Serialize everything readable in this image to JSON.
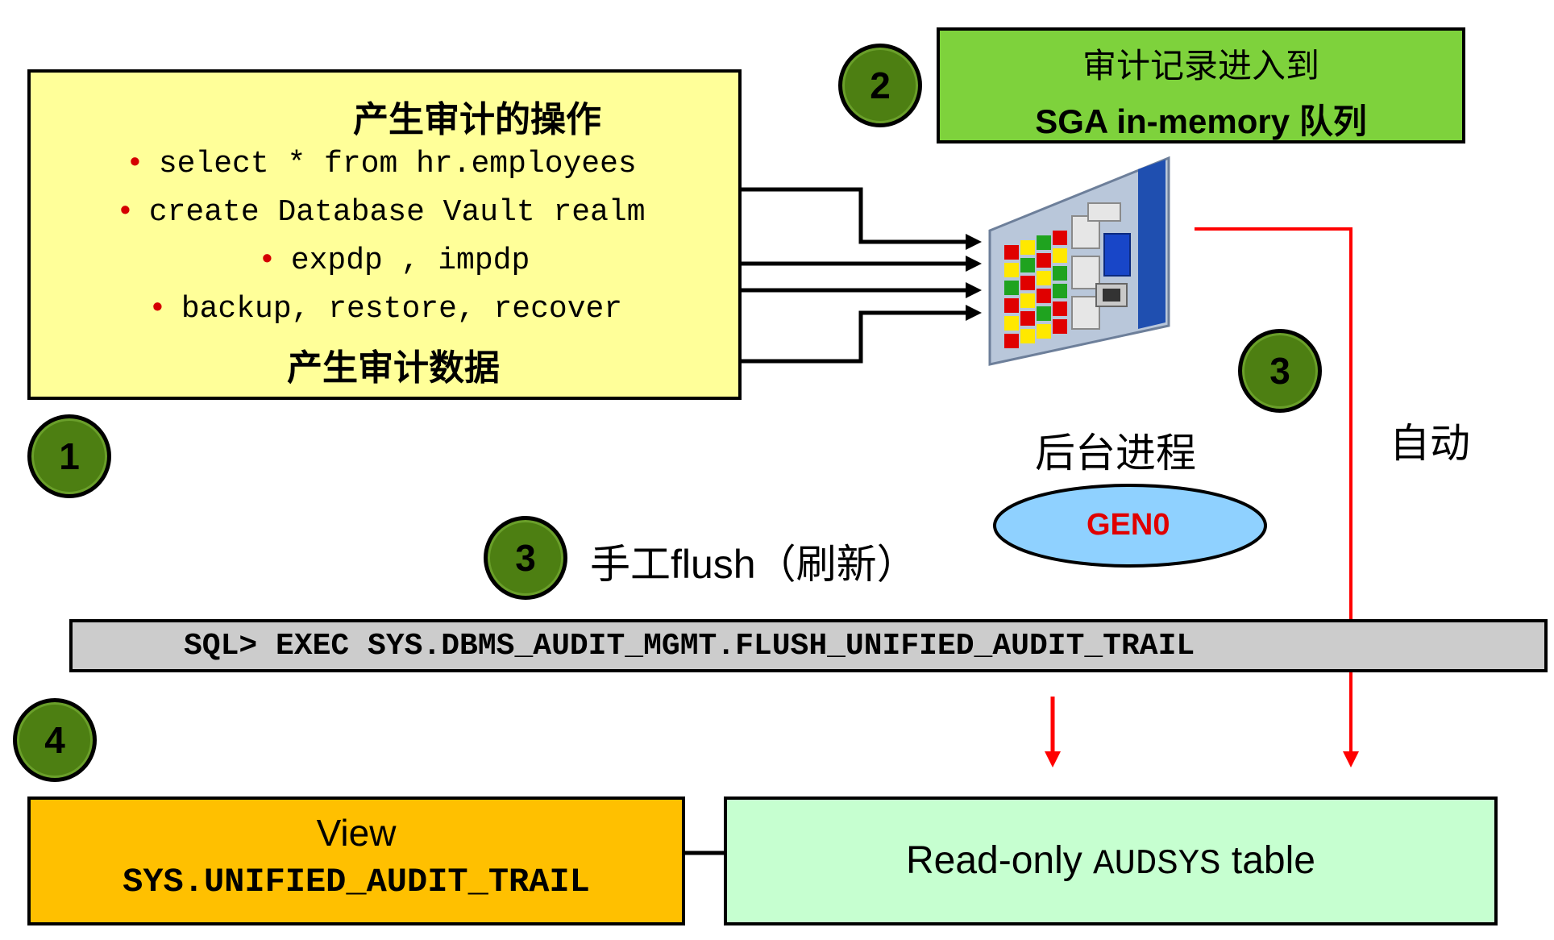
{
  "operations_box": {
    "title": "产生审计的操作",
    "items": [
      "select * from hr.employees",
      "create Database Vault realm",
      "expdp , impdp",
      "backup, restore, recover"
    ],
    "bullet": "•",
    "footer": "产生审计数据"
  },
  "sga_box": {
    "line1": "审计记录进入到",
    "line2": "SGA in-memory 队列"
  },
  "steps": {
    "one": "1",
    "two": "2",
    "three_auto": "3",
    "three_manual": "3",
    "four": "4"
  },
  "background_process_label": "后台进程",
  "gen0_label": "GEN0",
  "auto_label": "自动",
  "manual_flush_label": "手工flush（刷新）",
  "sql_command": "SQL> EXEC SYS.DBMS_AUDIT_MGMT.FLUSH_UNIFIED_AUDIT_TRAIL",
  "view_box": {
    "line1": "View",
    "line2": "SYS.UNIFIED_AUDIT_TRAIL"
  },
  "table_box": {
    "prefix": "Read-only ",
    "mono": "AUDSYS",
    "suffix": " table"
  },
  "colors": {
    "operations_fill": "#ffff99",
    "sga_fill": "#7ed23c",
    "step_circle": "#4d7f12",
    "gen0_fill": "#8fd1ff",
    "gen0_text": "#e00000",
    "sql_bar_fill": "#cccccc",
    "view_fill": "#ffc000",
    "table_fill": "#c6ffd0",
    "red_arrow": "#ff0000"
  }
}
